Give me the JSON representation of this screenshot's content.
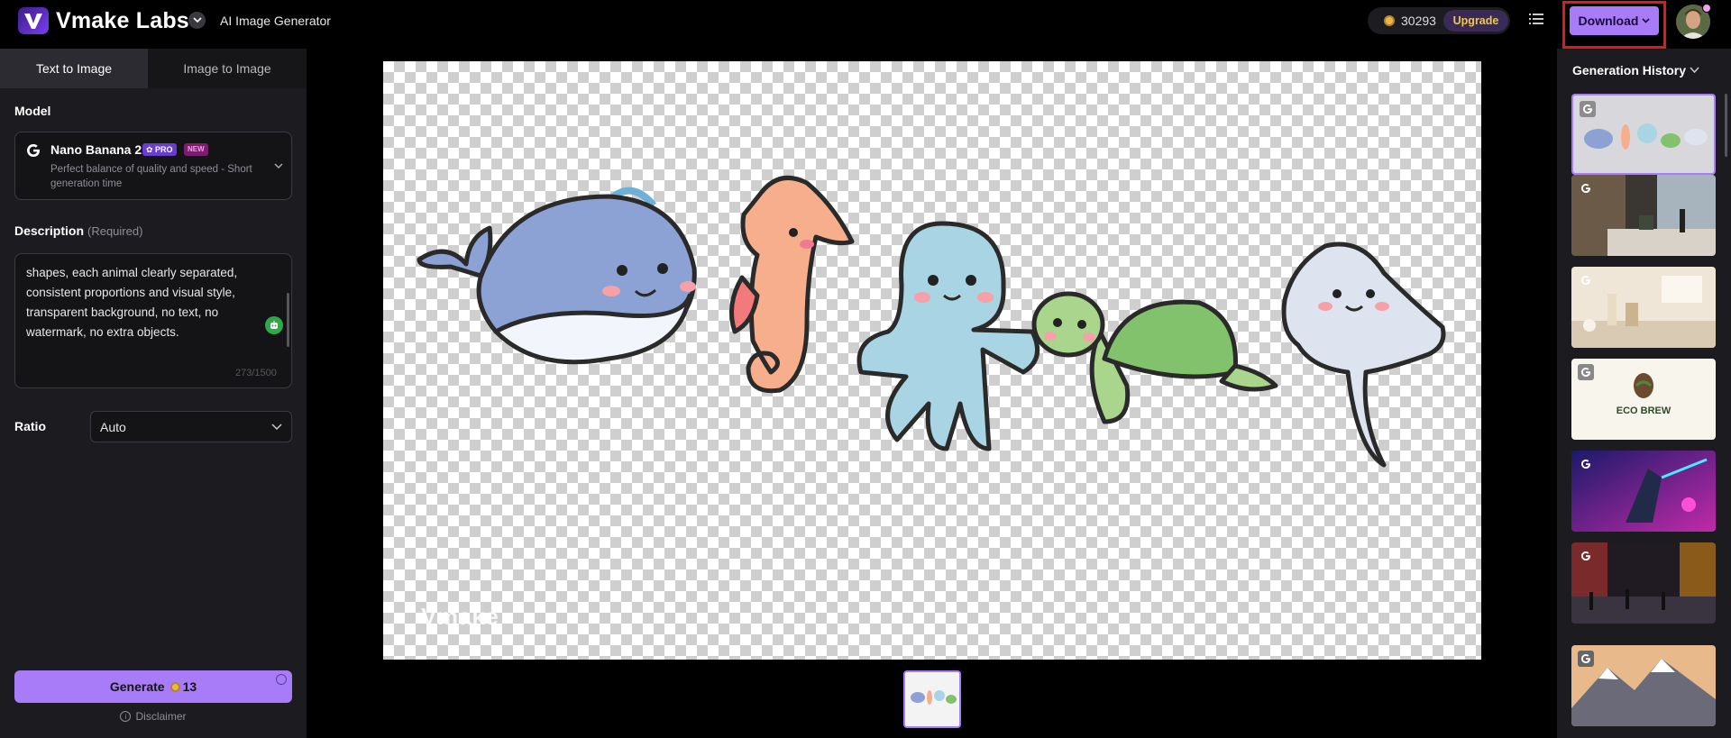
{
  "header": {
    "brand": "Vmake Labs",
    "app_name": "AI Image Generator",
    "credits": "30293",
    "upgrade_label": "Upgrade",
    "download_label": "Download"
  },
  "left_panel": {
    "tabs": [
      {
        "label": "Text to Image",
        "active": true
      },
      {
        "label": "Image to Image",
        "active": false
      }
    ],
    "model_label": "Model",
    "model": {
      "name": "Nano Banana 2",
      "pro_badge": "✿ PRO",
      "new_badge": "NEW",
      "description": "Perfect balance of quality and speed - Short generation time"
    },
    "description_label": "Description",
    "description_required": "(Required)",
    "description_text": "shapes, each animal clearly separated, consistent proportions and visual style, transparent background, no text, no watermark, no extra objects.",
    "char_count": "273/1500",
    "ratio_label": "Ratio",
    "ratio_value": "Auto",
    "generate_label": "Generate",
    "generate_cost": "13",
    "disclaimer": "Disclaimer"
  },
  "canvas": {
    "watermark": "Vmake",
    "subjects": [
      "whale",
      "seahorse",
      "octopus",
      "turtle",
      "stingray"
    ]
  },
  "history": {
    "title": "Generation History",
    "items": [
      {
        "name": "sea-animals-stickers",
        "selected": true
      },
      {
        "name": "hotel-lobby"
      },
      {
        "name": "lumiere-perfume"
      },
      {
        "name": "eco-brew-logo",
        "text": "ECO BREW"
      },
      {
        "name": "cyberpunk-warrior"
      },
      {
        "name": "neon-city-street"
      },
      {
        "name": "snowy-mountains"
      }
    ]
  },
  "colors": {
    "accent": "#a87cf8",
    "highlight_box": "#e01a1a",
    "panel_bg": "#1c1c20"
  }
}
